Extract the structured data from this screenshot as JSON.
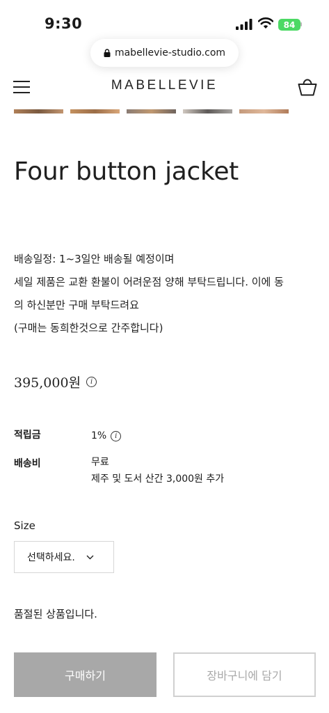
{
  "status_bar": {
    "time": "9:30",
    "battery": "84",
    "icons": [
      "signal-icon",
      "wifi-icon",
      "battery-icon"
    ]
  },
  "browser": {
    "url": "mabellevie-studio.com"
  },
  "header": {
    "logo": "MABELLEVIE",
    "icons": [
      "menu-icon",
      "shopping-bag-icon"
    ]
  },
  "product": {
    "title": "Four button jacket",
    "description": [
      "배송일정: 1~3일안 배송될 예정이며",
      "세일 제품은 교환 환불이 어려운점 양해 부탁드립니다. 이에 동",
      "의 하신분만 구매 부탁드려요",
      "(구매는 동희한것으로 간주합니다)"
    ],
    "price": "395,000원",
    "points_label": "적립금",
    "points_value": "1%",
    "shipping_label": "배송비",
    "shipping_value": "무료",
    "shipping_note": "제주 및 도서 산간 3,000원 추가",
    "info_symbol": "i"
  },
  "options": {
    "size_label": "Size",
    "size_selected": "선택하세요."
  },
  "stock": {
    "message": "품절된 상품입니다."
  },
  "actions": {
    "buy_label": "구매하기",
    "add_to_cart_label": "장바구니에 담기"
  },
  "colors": {
    "buy_button_bg": "#a8a8a8",
    "battery_green": "#4cd964"
  }
}
